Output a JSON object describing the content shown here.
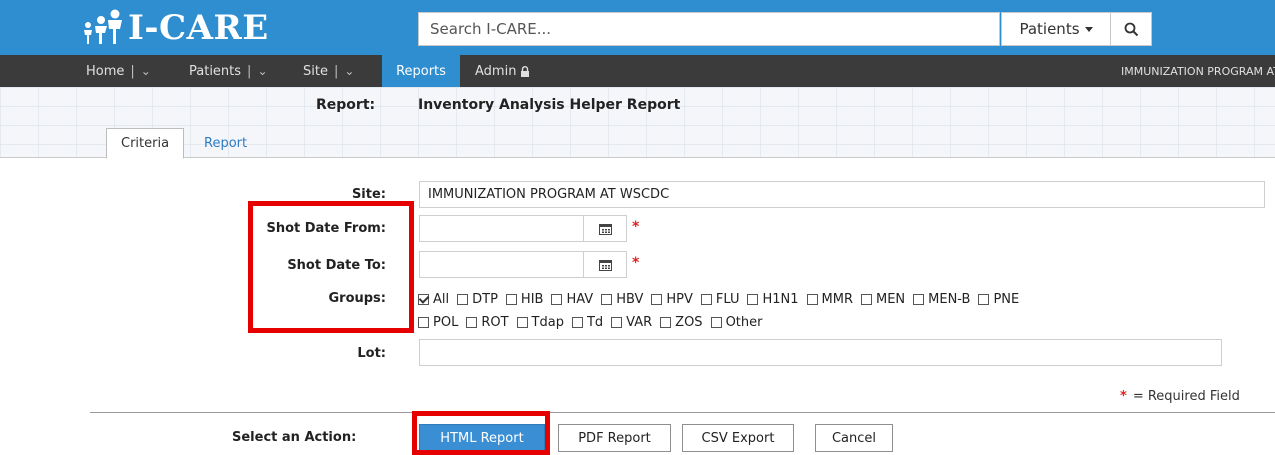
{
  "app": {
    "logo_text": "I-CARE"
  },
  "search": {
    "placeholder": "Search I-CARE...",
    "scope_label": "Patients",
    "button_icon": "search-icon"
  },
  "nav": {
    "items": [
      {
        "label": "Home",
        "sep": "|",
        "chevron": "⌄"
      },
      {
        "label": "Patients",
        "sep": "|",
        "chevron": "⌄"
      },
      {
        "label": "Site",
        "sep": "|",
        "chevron": "⌄"
      },
      {
        "label": "Reports"
      },
      {
        "label": "Admin",
        "icon": "lock-icon"
      }
    ],
    "site_name": "IMMUNIZATION PROGRAM AT WSCDC"
  },
  "report": {
    "label": "Report:",
    "title": "Inventory Analysis Helper Report",
    "tabs": [
      "Criteria",
      "Report"
    ]
  },
  "form": {
    "site_label": "Site:",
    "site_value": "IMMUNIZATION PROGRAM AT WSCDC",
    "date_from_label": "Shot Date From:",
    "date_to_label": "Shot Date To:",
    "groups_label": "Groups:",
    "lot_label": "Lot:",
    "required_star": "*",
    "required_note": "= Required Field",
    "groups": [
      {
        "label": "All",
        "checked": true
      },
      {
        "label": "DTP",
        "checked": false
      },
      {
        "label": "HIB",
        "checked": false
      },
      {
        "label": "HAV",
        "checked": false
      },
      {
        "label": "HBV",
        "checked": false
      },
      {
        "label": "HPV",
        "checked": false
      },
      {
        "label": "FLU",
        "checked": false
      },
      {
        "label": "H1N1",
        "checked": false
      },
      {
        "label": "MMR",
        "checked": false
      },
      {
        "label": "MEN",
        "checked": false
      },
      {
        "label": "MEN-B",
        "checked": false
      },
      {
        "label": "PNE",
        "checked": false
      },
      {
        "label": "POL",
        "checked": false
      },
      {
        "label": "ROT",
        "checked": false
      },
      {
        "label": "Tdap",
        "checked": false
      },
      {
        "label": "Td",
        "checked": false
      },
      {
        "label": "VAR",
        "checked": false
      },
      {
        "label": "ZOS",
        "checked": false
      },
      {
        "label": "Other",
        "checked": false
      }
    ]
  },
  "actions": {
    "label": "Select an Action:",
    "buttons": [
      "HTML Report",
      "PDF Report",
      "CSV Export",
      "Cancel"
    ]
  },
  "colors": {
    "brand_blue": "#2e8ed0",
    "nav_dark": "#3b3b3b",
    "highlight_red": "#e60000",
    "required_red": "#e02020"
  }
}
